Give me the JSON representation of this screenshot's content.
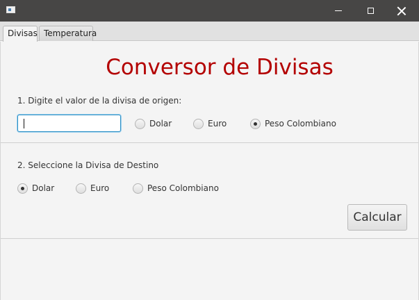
{
  "window": {
    "title": ""
  },
  "tabs": [
    {
      "label": "Divisas",
      "active": true
    },
    {
      "label": "Temperatura",
      "active": false
    }
  ],
  "main": {
    "heading": "Conversor de Divisas",
    "origin_prompt": "1. Digite el valor de la divisa de origen:",
    "amount_value": "",
    "origin_options": [
      {
        "label": "Dolar",
        "selected": false
      },
      {
        "label": "Euro",
        "selected": false
      },
      {
        "label": "Peso Colombiano",
        "selected": true
      }
    ],
    "destination_prompt": "2. Seleccione la Divisa de Destino",
    "destination_options": [
      {
        "label": "Dolar",
        "selected": true
      },
      {
        "label": "Euro",
        "selected": false
      },
      {
        "label": "Peso Colombiano",
        "selected": false
      }
    ],
    "calculate_label": "Calcular"
  },
  "colors": {
    "heading": "#b30000",
    "titlebar": "#474645",
    "focus_border": "#2e90c5"
  }
}
